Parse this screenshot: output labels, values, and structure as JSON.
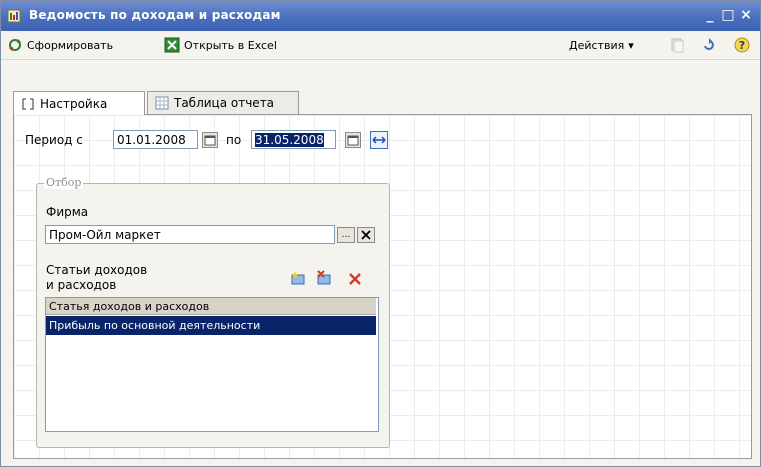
{
  "window": {
    "title": "Ведомость по доходам и расходам",
    "minimize": "_",
    "maximize": "□",
    "close": "×"
  },
  "toolbar": {
    "generate_label": "Сформировать",
    "open_excel_label": "Открыть в Excel",
    "actions_label": "Действия",
    "actions_arrow": "▾",
    "help_label": "?"
  },
  "tabs": [
    {
      "label": "Настройка",
      "active": true
    },
    {
      "label": "Таблица отчета",
      "active": false
    }
  ],
  "period": {
    "from_label": "Период с",
    "from_value": "01.01.2008",
    "to_label": "по",
    "to_value": "31.05.2008"
  },
  "filter": {
    "group_title": "Отбор",
    "firm_label": "Фирма",
    "firm_value": "Пром-Ойл маркет",
    "articles_label_1": "Статьи доходов",
    "articles_label_2": "и расходов",
    "list_header": "Статья доходов и расходов",
    "rows": [
      "Прибыль по основной деятельности"
    ]
  },
  "colors": {
    "title_bar": "#4a6fbe",
    "selection": "#0a246a",
    "delete_red": "#d03a2a"
  }
}
